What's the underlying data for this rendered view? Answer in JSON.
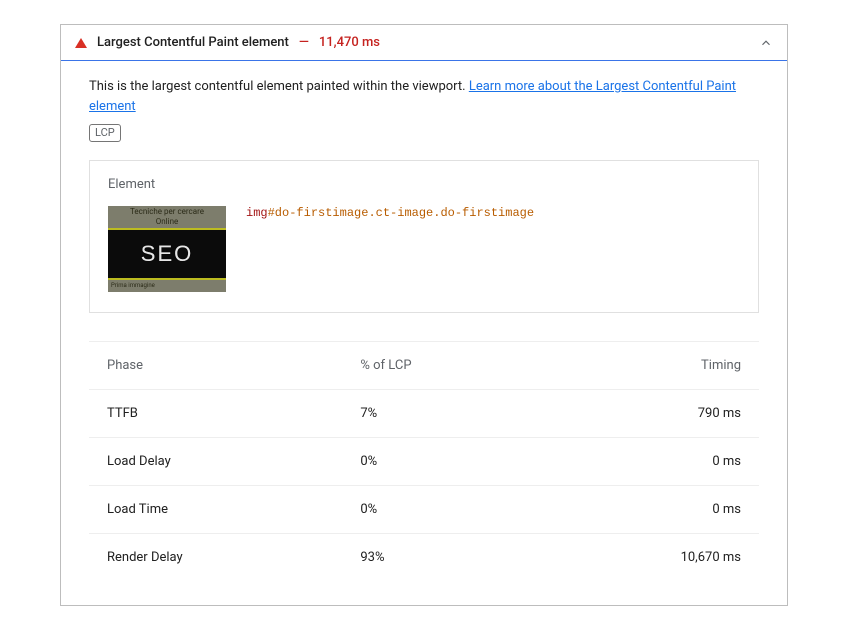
{
  "audit": {
    "title": "Largest Contentful Paint element",
    "dash": "—",
    "time": "11,470 ms"
  },
  "intro": {
    "text": "This is the largest contentful element painted within the viewport. ",
    "link_text": "Learn more about the Largest Contentful Paint element",
    "badge": "LCP"
  },
  "element": {
    "heading": "Element",
    "thumb_top_line1": "Tecniche per cercare",
    "thumb_top_line2": "Online",
    "thumb_seo": "SEO",
    "thumb_bottom": "Prima immagine",
    "selector_tag": "img",
    "selector_id": "#do-firstimage",
    "selector_classes": ".ct-image.do-firstimage"
  },
  "table": {
    "headers": {
      "phase": "Phase",
      "pct": "% of LCP",
      "timing": "Timing"
    },
    "rows": [
      {
        "phase": "TTFB",
        "pct": "7%",
        "timing": "790 ms"
      },
      {
        "phase": "Load Delay",
        "pct": "0%",
        "timing": "0 ms"
      },
      {
        "phase": "Load Time",
        "pct": "0%",
        "timing": "0 ms"
      },
      {
        "phase": "Render Delay",
        "pct": "93%",
        "timing": "10,670 ms"
      }
    ]
  }
}
